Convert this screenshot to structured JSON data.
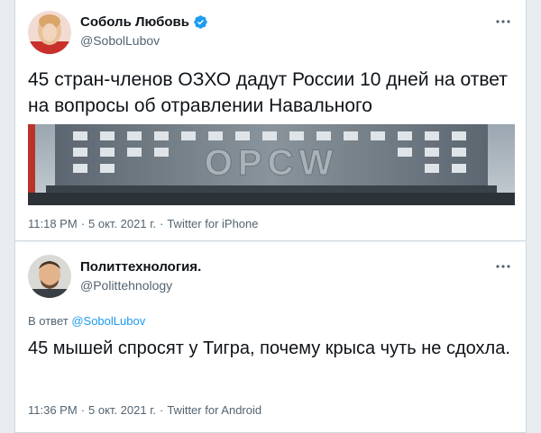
{
  "tweets": [
    {
      "author_name": "Соболь Любовь",
      "handle": "@SobolLubov",
      "verified": true,
      "text": "45 стран-членов ОЗХО дадут России 10 дней на ответ на вопросы об отравлении Навального",
      "media_text": "OPCW",
      "time": "11:18 PM",
      "date": "5 окт. 2021 г.",
      "source": "Twitter for iPhone",
      "more_icon": "more-icon"
    },
    {
      "author_name": "Политтехнология.",
      "handle": "@Polittehnology",
      "verified": false,
      "reply_prefix": "В ответ",
      "reply_handle": "@SobolLubov",
      "text": "45 мышей спросят у Тигра, почему крыса чуть не сдохла.",
      "time": "11:36 PM",
      "date": "5 окт. 2021 г.",
      "source": "Twitter for Android",
      "more_icon": "more-icon"
    }
  ],
  "separator": "·",
  "colors": {
    "accent": "#1d9bf0",
    "secondary_text": "#536471",
    "primary_text": "#0f1419",
    "background": "#e6ecf0"
  }
}
